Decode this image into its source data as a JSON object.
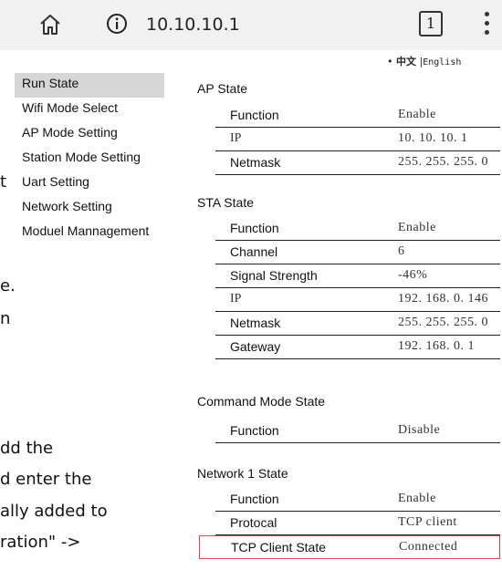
{
  "browser": {
    "url": "10.10.10.1",
    "tab_count": "1"
  },
  "language": {
    "cn": "中文",
    "sep": "|",
    "en": "English"
  },
  "nav": {
    "items": [
      {
        "label": "Run State",
        "active": true
      },
      {
        "label": "Wifi Mode Select"
      },
      {
        "label": "AP Mode Setting"
      },
      {
        "label": "Station Mode Setting"
      },
      {
        "label": "Uart Setting"
      },
      {
        "label": "Network Setting"
      },
      {
        "label": "Moduel Mannagement"
      }
    ]
  },
  "background_text": {
    "t": "t",
    "e": "e.",
    "n": "n",
    "l1": "dd the",
    "l2": "d enter the",
    "l3": "ally added to",
    "l4": "ration\" ->"
  },
  "ap_state": {
    "title": "AP State",
    "rows": [
      {
        "key": "Function",
        "value": "Enable"
      },
      {
        "key": "IP",
        "value": "10. 10. 10. 1"
      },
      {
        "key": "Netmask",
        "value": "255. 255. 255. 0"
      }
    ]
  },
  "sta_state": {
    "title": "STA State",
    "rows": [
      {
        "key": "Function",
        "value": "Enable"
      },
      {
        "key": "Channel",
        "value": "6"
      },
      {
        "key": "Signal Strength",
        "value": "-46%"
      },
      {
        "key": "IP",
        "value": "192. 168. 0. 146"
      },
      {
        "key": "Netmask",
        "value": "255. 255. 255. 0"
      },
      {
        "key": "Gateway",
        "value": "192. 168. 0. 1"
      }
    ]
  },
  "command_mode": {
    "title": "Command Mode State",
    "rows": [
      {
        "key": "Function",
        "value": "Disable"
      }
    ]
  },
  "network1": {
    "title": "Network 1 State",
    "rows": [
      {
        "key": "Function",
        "value": "Enable"
      },
      {
        "key": "Protocal",
        "value": "TCP client"
      },
      {
        "key": "TCP Client State",
        "value": "Connected"
      }
    ]
  }
}
